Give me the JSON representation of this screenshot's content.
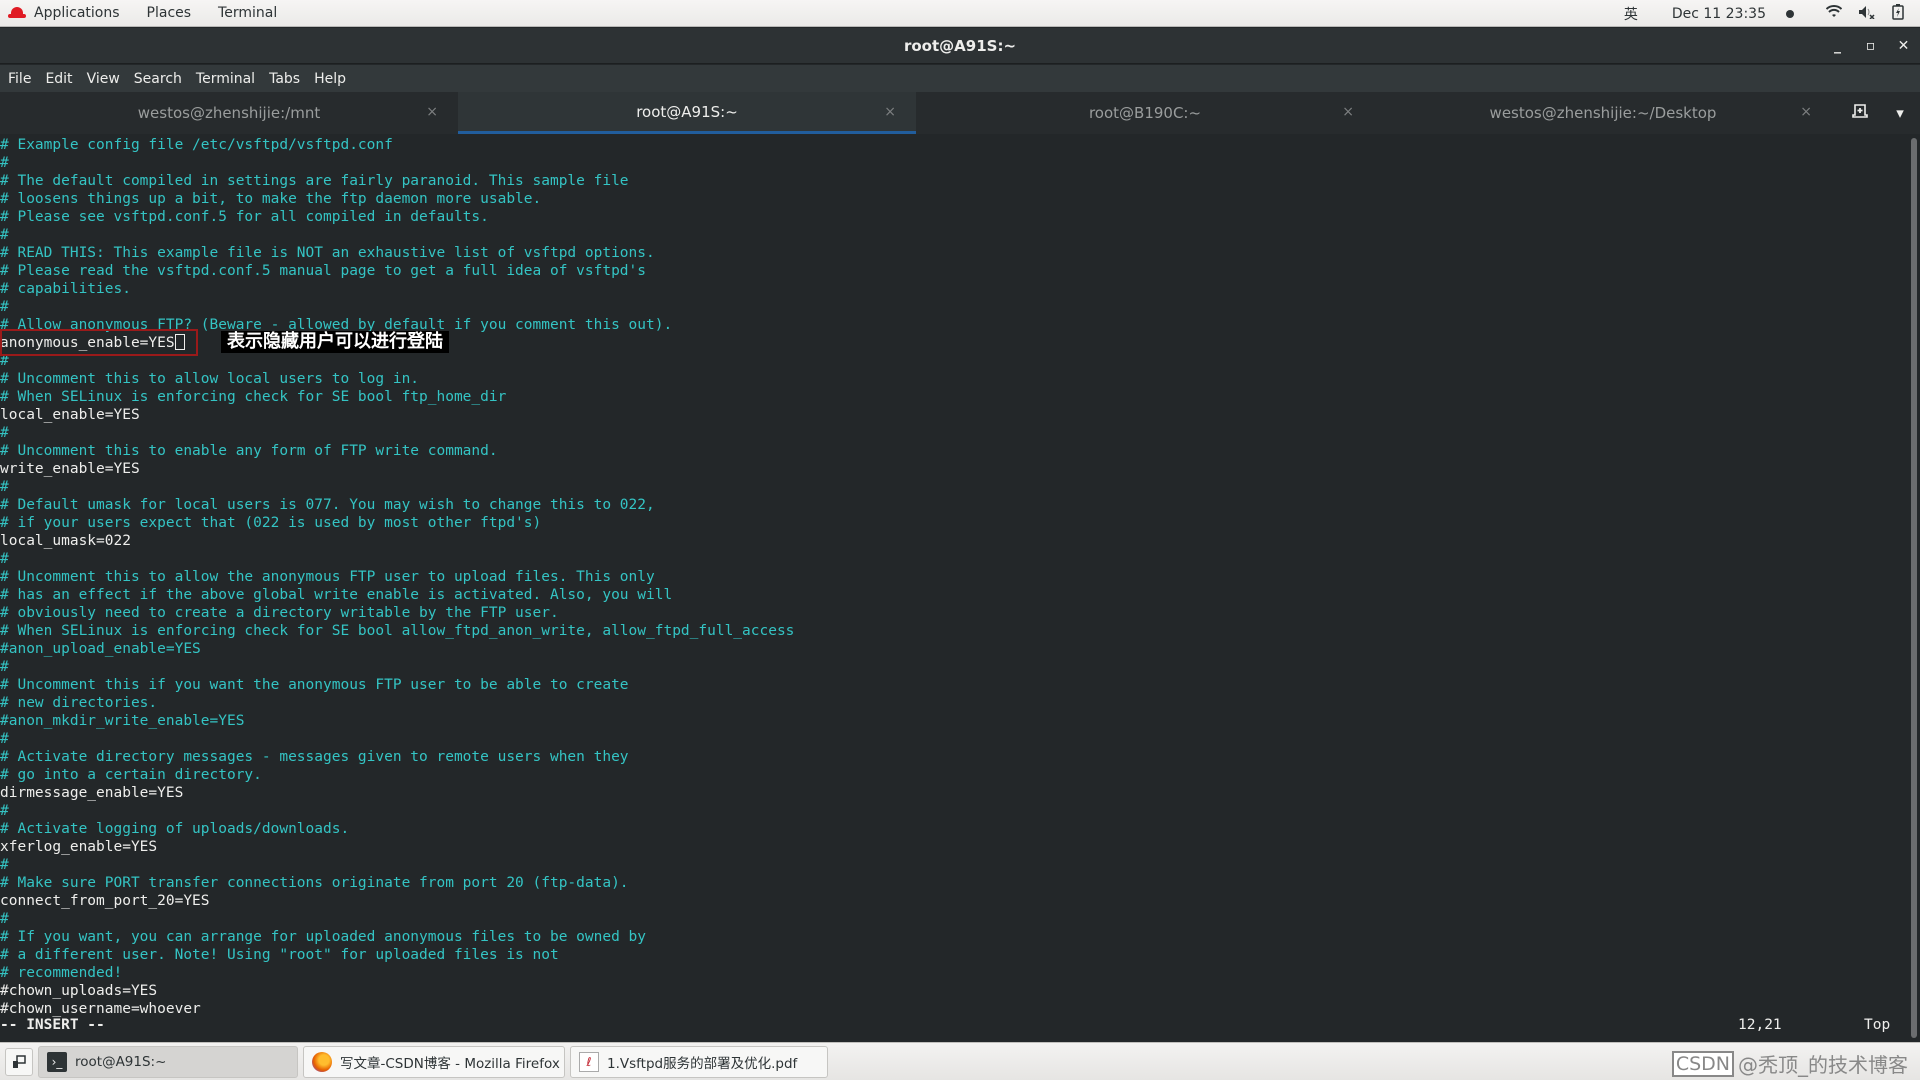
{
  "topbar": {
    "applications": "Applications",
    "places": "Places",
    "terminal": "Terminal",
    "input_method": "英",
    "datetime": "Dec 11  23:35",
    "wifi_icon": "wifi-icon",
    "volume_icon": "volume-muted-icon",
    "battery_icon": "battery-charging-icon"
  },
  "window": {
    "title": "root@A91S:~",
    "minimize": "_",
    "maximize": "▫",
    "close": "✕"
  },
  "menubar": [
    "File",
    "Edit",
    "View",
    "Search",
    "Terminal",
    "Tabs",
    "Help"
  ],
  "tabs": [
    {
      "label": "westos@zhenshijie:/mnt",
      "active": false
    },
    {
      "label": "root@A91S:~",
      "active": true
    },
    {
      "label": "root@B190C:~",
      "active": false
    },
    {
      "label": "westos@zhenshijie:~/Desktop",
      "active": false
    }
  ],
  "tab_close": "×",
  "tab_actions": {
    "new_tab": "⊞",
    "menu": "▾"
  },
  "editor": {
    "lines": [
      {
        "t": "# Example config file /etc/vsftpd/vsftpd.conf",
        "c": true
      },
      {
        "t": "#",
        "c": true
      },
      {
        "t": "# The default compiled in settings are fairly paranoid. This sample file",
        "c": true
      },
      {
        "t": "# loosens things up a bit, to make the ftp daemon more usable.",
        "c": true
      },
      {
        "t": "# Please see vsftpd.conf.5 for all compiled in defaults.",
        "c": true
      },
      {
        "t": "#",
        "c": true
      },
      {
        "t": "# READ THIS: This example file is NOT an exhaustive list of vsftpd options.",
        "c": true
      },
      {
        "t": "# Please read the vsftpd.conf.5 manual page to get a full idea of vsftpd's",
        "c": true
      },
      {
        "t": "# capabilities.",
        "c": true
      },
      {
        "t": "#",
        "c": true
      },
      {
        "t": "# Allow anonymous FTP? (Beware - allowed by default if you comment this out).",
        "c": true
      },
      {
        "t": "anonymous_enable=YES",
        "c": false,
        "cursor": true
      },
      {
        "t": "#",
        "c": true
      },
      {
        "t": "# Uncomment this to allow local users to log in.",
        "c": true
      },
      {
        "t": "# When SELinux is enforcing check for SE bool ftp_home_dir",
        "c": true
      },
      {
        "t": "local_enable=YES",
        "c": false
      },
      {
        "t": "#",
        "c": true
      },
      {
        "t": "# Uncomment this to enable any form of FTP write command.",
        "c": true
      },
      {
        "t": "write_enable=YES",
        "c": false
      },
      {
        "t": "#",
        "c": true
      },
      {
        "t": "# Default umask for local users is 077. You may wish to change this to 022,",
        "c": true
      },
      {
        "t": "# if your users expect that (022 is used by most other ftpd's)",
        "c": true
      },
      {
        "t": "local_umask=022",
        "c": false
      },
      {
        "t": "#",
        "c": true
      },
      {
        "t": "# Uncomment this to allow the anonymous FTP user to upload files. This only",
        "c": true
      },
      {
        "t": "# has an effect if the above global write enable is activated. Also, you will",
        "c": true
      },
      {
        "t": "# obviously need to create a directory writable by the FTP user.",
        "c": true
      },
      {
        "t": "# When SELinux is enforcing check for SE bool allow_ftpd_anon_write, allow_ftpd_full_access",
        "c": true
      },
      {
        "t": "#anon_upload_enable=YES",
        "c": true
      },
      {
        "t": "#",
        "c": true
      },
      {
        "t": "# Uncomment this if you want the anonymous FTP user to be able to create",
        "c": true
      },
      {
        "t": "# new directories.",
        "c": true
      },
      {
        "t": "#anon_mkdir_write_enable=YES",
        "c": true
      },
      {
        "t": "#",
        "c": true
      },
      {
        "t": "# Activate directory messages - messages given to remote users when they",
        "c": true
      },
      {
        "t": "# go into a certain directory.",
        "c": true
      },
      {
        "t": "dirmessage_enable=YES",
        "c": false
      },
      {
        "t": "#",
        "c": true
      },
      {
        "t": "# Activate logging of uploads/downloads.",
        "c": true
      },
      {
        "t": "xferlog_enable=YES",
        "c": false
      },
      {
        "t": "#",
        "c": true
      },
      {
        "t": "# Make sure PORT transfer connections originate from port 20 (ftp-data).",
        "c": true
      },
      {
        "t": "connect_from_port_20=YES",
        "c": false
      },
      {
        "t": "#",
        "c": true
      },
      {
        "t": "# If you want, you can arrange for uploaded anonymous files to be owned by",
        "c": true
      },
      {
        "t": "# a different user. Note! Using \"root\" for uploaded files is not",
        "c": true
      },
      {
        "t": "# recommended!",
        "c": true
      },
      {
        "t": "#chown_uploads=YES",
        "c": false
      },
      {
        "t": "#chown_username=whoever",
        "c": false
      }
    ],
    "annotation": "表示隐藏用户可以进行登陆",
    "mode": "-- INSERT --",
    "cursor_position": "12,21",
    "scroll_position": "Top"
  },
  "taskbar": {
    "show_desktop_icon": "show-desktop-icon",
    "tasks": [
      {
        "label": "root@A91S:~",
        "icon": "terminal-icon",
        "active": true
      },
      {
        "label": "写文章-CSDN博客 - Mozilla Firefox",
        "icon": "firefox-icon",
        "active": false
      },
      {
        "label": "1.Vsftpd服务的部署及优化.pdf",
        "icon": "pdf-icon",
        "active": false
      }
    ],
    "watermark_badge": "CSDN",
    "watermark_text": "@秃顶_的技术博客"
  }
}
